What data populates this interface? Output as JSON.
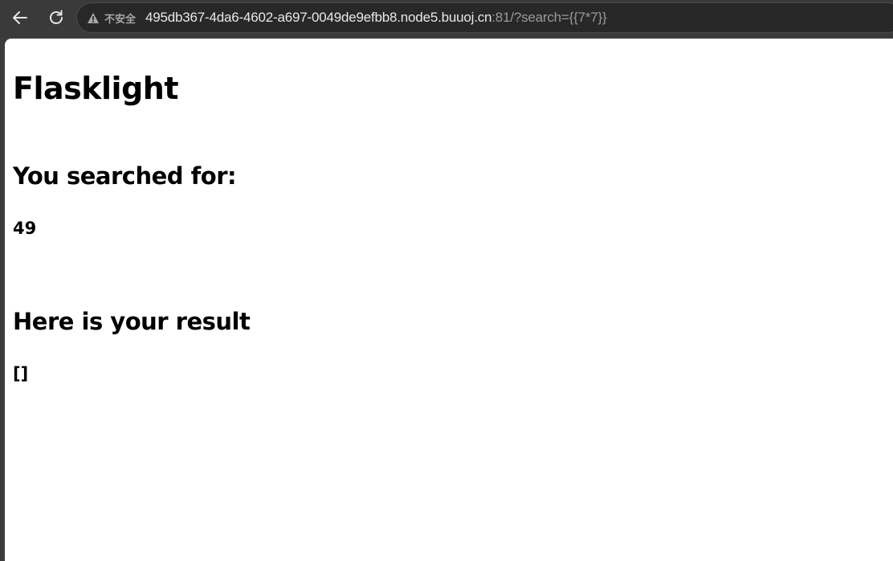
{
  "browser": {
    "security_label": "不安全",
    "url_host": "495db367-4da6-4602-a697-0049de9efbb8.node5.buuoj.cn",
    "url_rest": ":81/?search={{7*7}}"
  },
  "page": {
    "title": "Flasklight",
    "searched_heading": "You searched for:",
    "searched_value": "49",
    "result_heading": "Here is your result",
    "result_value": "[]"
  }
}
